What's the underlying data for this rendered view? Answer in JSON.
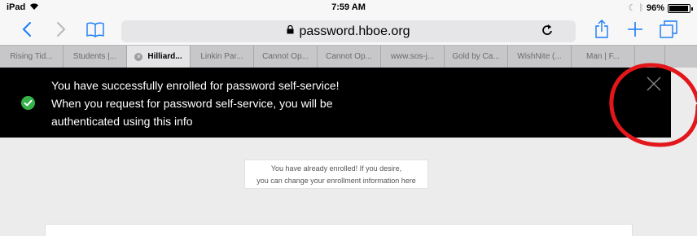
{
  "status_bar": {
    "device": "iPad",
    "time": "7:59 AM",
    "battery": "96%",
    "wifi_icon": "wifi-icon",
    "bluetooth_icon": "bluetooth-icon"
  },
  "toolbar": {
    "url": "password.hboe.org",
    "back_icon": "chevron-left-icon",
    "forward_icon": "chevron-right-icon",
    "bookmarks_icon": "book-icon",
    "reload_icon": "reload-icon",
    "share_icon": "share-icon",
    "add_icon": "plus-icon",
    "tabs_icon": "tabs-icon"
  },
  "tabs": [
    {
      "label": "Rising Tid...",
      "active": false
    },
    {
      "label": "Students |...",
      "active": false
    },
    {
      "label": "Hilliard...",
      "active": true
    },
    {
      "label": "Linkin Par...",
      "active": false
    },
    {
      "label": "Cannot Op...",
      "active": false
    },
    {
      "label": "Cannot Op...",
      "active": false
    },
    {
      "label": "www.sos-j...",
      "active": false
    },
    {
      "label": "Gold by Ca...",
      "active": false
    },
    {
      "label": "WishNite (...",
      "active": false
    },
    {
      "label": "Man | F...",
      "active": false
    }
  ],
  "banner": {
    "line1": "You have successfully enrolled for password self-service!",
    "line2": "When you request for password self-service, you will be",
    "line3": "authenticated using this info",
    "status_color": "#35b34a"
  },
  "notice": {
    "line1": "You have already enrolled! If you desire,",
    "line2": "you can change your enrollment information here"
  },
  "colors": {
    "banner_bg": "#000000",
    "annotation": "#e2161b",
    "page_bg": "#ececec"
  }
}
